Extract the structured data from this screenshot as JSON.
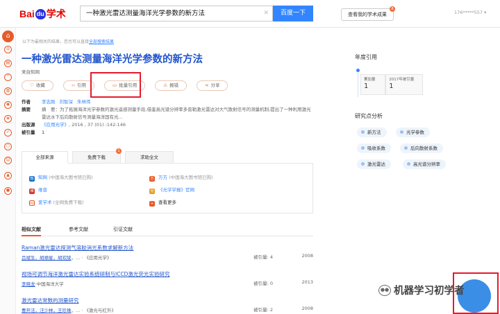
{
  "header": {
    "logo_bai": "Bai",
    "logo_du": "du",
    "logo_xueshu": "学术",
    "search_value": "一种激光雷达测量海洋光学参数的新方法",
    "search_button": "百度一下",
    "my_achievements": "查看我的学术成果",
    "my_badge": "8",
    "user": "176*****557"
  },
  "hint": {
    "text": "以下为最相关的结果，您也可以直接",
    "link": "全部搜索结果"
  },
  "paper": {
    "title": "一种激光雷达测量海洋光学参数的新方法",
    "source": "来自知网",
    "actions": [
      "收藏",
      "引用",
      "批量引用",
      "报错",
      "分享"
    ],
    "labels": {
      "authors": "作者",
      "abstract": "摘要",
      "publication": "出版源",
      "cited": "被引量"
    },
    "authors": [
      "李志刚",
      "刘智深",
      "朱林伟"
    ],
    "abstract": "摘　要：为了拓展海洋光学参数的激光遥感测量手段,借鉴高光谱分辨率多普勒激光雷达对大气散射信号的测量机制,提出了一种利用激光雷达水下后向散射信号测量海洋固有光...",
    "publication_journal": "《应用光学》",
    "publication_detail": ", 2016 , 37 (01) :142-146",
    "cited": "1"
  },
  "source_tabs": [
    "全部来源",
    "免费下载",
    "求助全文"
  ],
  "source_tab_badge": "1",
  "sources": [
    {
      "name": "知网",
      "note": "(中国海大图书馆已购)"
    },
    {
      "name": "万方",
      "note": "(中国海大图书馆已购)"
    },
    {
      "name": "维普",
      "note": ""
    },
    {
      "name": "《光学学报》官网",
      "note": ""
    },
    {
      "name": "爱学术",
      "note": "(全网免费下载)"
    },
    {
      "name": "查看更多",
      "note": ""
    }
  ],
  "related_tabs": [
    "相似文献",
    "参考文献",
    "引证文献"
  ],
  "related": [
    {
      "title": "Raman激光雷达探测气溶胶消光系数求解新方法",
      "authors_linked": "吕斌生，胡顺星，胡欢陵",
      "authors_rest": "，...",
      "journal": "《应用光学》",
      "cited_label": "被引量: 4",
      "year": "2008"
    },
    {
      "title": "视场可调节海洋激光雷达实验系统研制与ICCD激光荧光实验研究",
      "authors_linked": "李晓龙",
      "authors_rest": "·中国海洋大学",
      "journal": "",
      "cited_label": "被引量: 0",
      "year": "2013"
    },
    {
      "title": "激光雷达常数的测量研究",
      "authors_linked": "曹开法，汪少林，王珍珠",
      "authors_rest": "，...",
      "journal": "《激光与红外》",
      "cited_label": "被引量: 2",
      "year": "2008"
    }
  ],
  "annual_citations": {
    "title": "年度引用",
    "total_label": "累加量",
    "total_value": "1",
    "year_label": "2017年被引量",
    "year_value": "1"
  },
  "research_points": {
    "title": "研究点分析",
    "keywords": [
      "新方法",
      "光学参数",
      "吸收系数",
      "后向散射系数",
      "激光雷达",
      "高光谱分辨率"
    ]
  },
  "sidebar_icons": [
    "home-icon",
    "scholar-icon",
    "chart-icon",
    "cite-icon",
    "book-icon",
    "discover-icon",
    "tag-icon",
    "pin-icon",
    "search-icon",
    "people-icon",
    "grad-cap-icon",
    "user-icon"
  ],
  "watermark": "机器学习初学者"
}
